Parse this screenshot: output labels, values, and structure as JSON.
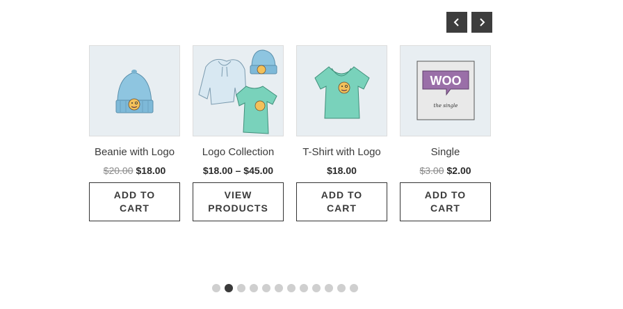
{
  "carousel": {
    "prev_icon": "chevron-left-icon",
    "next_icon": "chevron-right-icon",
    "nav_color": "#3d3d3d",
    "dot_count": 12,
    "active_dot": 1
  },
  "products": [
    {
      "title": "Beanie with Logo",
      "price_old": "$20.00",
      "price": "$18.00",
      "cta": "ADD TO CART",
      "image": "beanie-image"
    },
    {
      "title": "Logo Collection",
      "price_old": "",
      "price": "$18.00 – $45.00",
      "cta": "VIEW PRODUCTS",
      "image": "collection-image"
    },
    {
      "title": "T-Shirt with Logo",
      "price_old": "",
      "price": "$18.00",
      "cta": "ADD TO CART",
      "image": "tshirt-image"
    },
    {
      "title": "Single",
      "price_old": "$3.00",
      "price": "$2.00",
      "cta": "ADD TO CART",
      "image": "single-album-image"
    }
  ],
  "single_art": {
    "logo_text": "WOO",
    "caption": "the single"
  }
}
